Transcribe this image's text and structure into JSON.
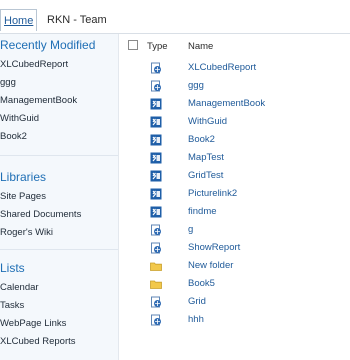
{
  "topbar": {
    "home_label": "Home",
    "site_label": "RKN - Team"
  },
  "leftnav": {
    "sections": [
      {
        "heading": "Recently Modified",
        "items": [
          "XLCubedReport",
          "ggg",
          "ManagementBook",
          "WithGuid",
          "Book2"
        ]
      },
      {
        "heading": "Libraries",
        "items": [
          "Site Pages",
          "Shared Documents",
          "Roger's Wiki"
        ]
      },
      {
        "heading": "Lists",
        "items": [
          "Calendar",
          "Tasks",
          "WebPage Links",
          "XLCubed Reports"
        ]
      }
    ]
  },
  "list": {
    "header": {
      "type_label": "Type",
      "name_label": "Name"
    },
    "rows": [
      {
        "name": "XLCubedReport",
        "icon": "web-page-icon"
      },
      {
        "name": "ggg",
        "icon": "web-page-icon"
      },
      {
        "name": "ManagementBook",
        "icon": "excel-icon"
      },
      {
        "name": "WithGuid",
        "icon": "excel-icon"
      },
      {
        "name": "Book2",
        "icon": "excel-icon"
      },
      {
        "name": "MapTest",
        "icon": "excel-icon"
      },
      {
        "name": "GridTest",
        "icon": "excel-icon"
      },
      {
        "name": "Picturelink2",
        "icon": "excel-icon"
      },
      {
        "name": "findme",
        "icon": "excel-icon"
      },
      {
        "name": "g",
        "icon": "web-page-icon"
      },
      {
        "name": "ShowReport",
        "icon": "web-page-icon"
      },
      {
        "name": "New folder",
        "icon": "folder-icon"
      },
      {
        "name": "Book5",
        "icon": "folder-icon"
      },
      {
        "name": "Grid",
        "icon": "web-page-icon"
      },
      {
        "name": "hhh",
        "icon": "web-page-icon"
      }
    ]
  }
}
